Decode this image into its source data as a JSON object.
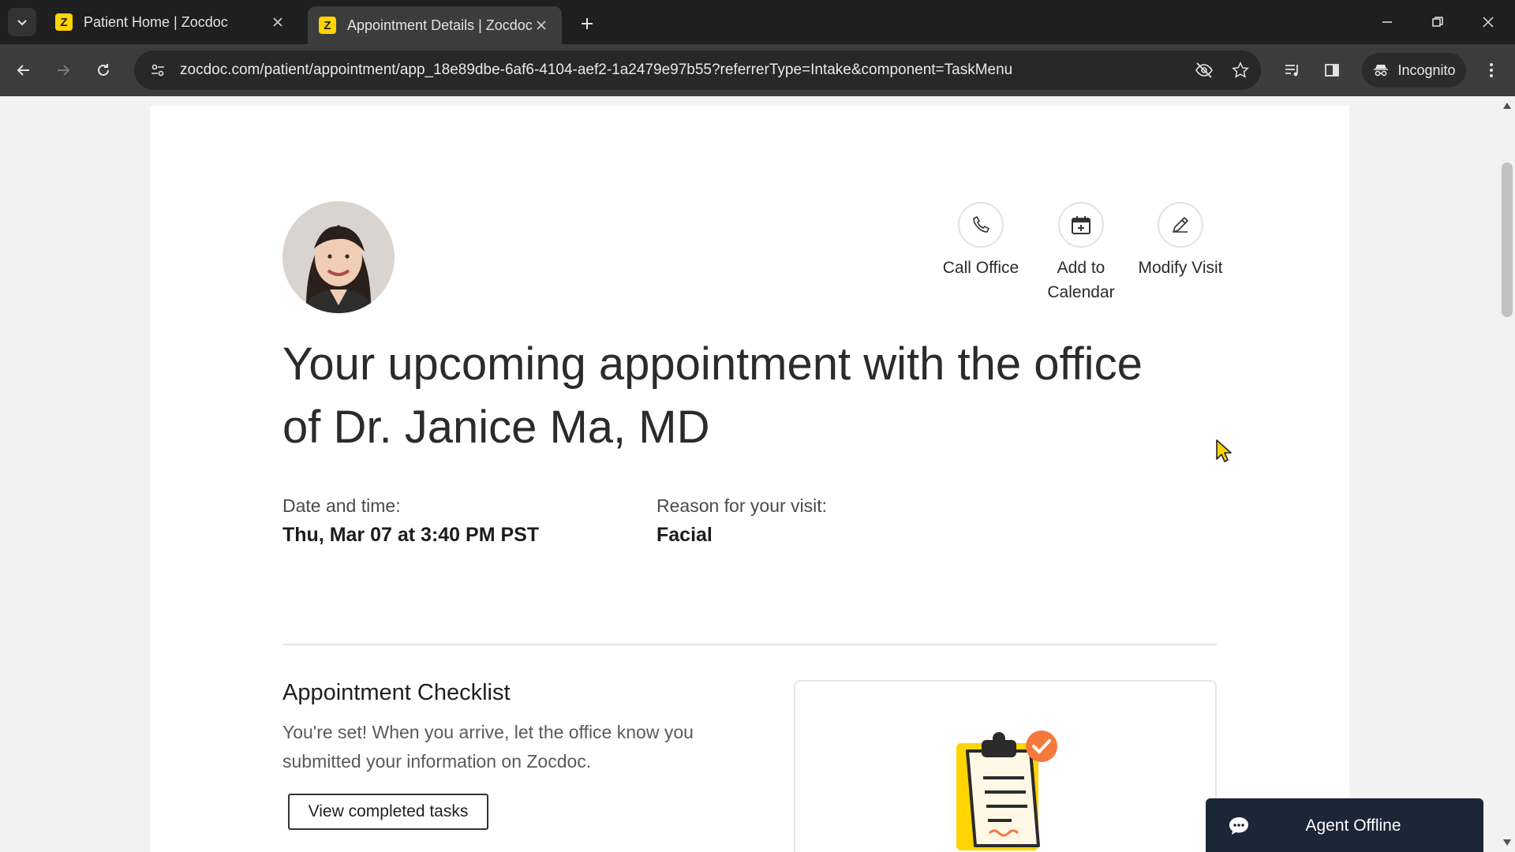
{
  "browser": {
    "tabs": [
      {
        "title": "Patient Home | Zocdoc",
        "favicon": "Z",
        "active": false
      },
      {
        "title": "Appointment Details | Zocdoc",
        "favicon": "Z",
        "active": true
      }
    ],
    "url": "zocdoc.com/patient/appointment/app_18e89dbe-6af6-4104-aef2-1a2479e97b55?referrerType=Intake&component=TaskMenu",
    "incognito_label": "Incognito"
  },
  "actions": {
    "call": "Call Office",
    "calendar": "Add to Calendar",
    "modify": "Modify Visit"
  },
  "appointment": {
    "headline": "Your upcoming appointment with the office of Dr. Janice Ma, MD",
    "date_label": "Date and time:",
    "date_value": "Thu, Mar 07 at 3:40 PM PST",
    "reason_label": "Reason for your visit:",
    "reason_value": "Facial"
  },
  "checklist": {
    "title": "Appointment Checklist",
    "description": "You're set! When you arrive, let the office know you submitted your information on Zocdoc.",
    "button": "View completed tasks"
  },
  "chat": {
    "label": "Agent Offline"
  },
  "colors": {
    "brand_yellow": "#ffd400",
    "check_orange": "#f5793a",
    "chat_bg": "#1b2637"
  }
}
